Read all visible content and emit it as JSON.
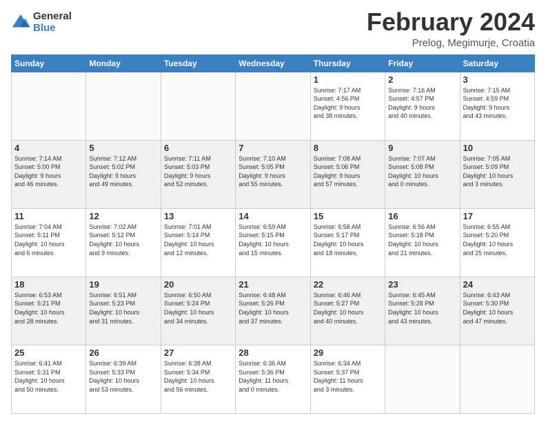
{
  "logo": {
    "general": "General",
    "blue": "Blue"
  },
  "header": {
    "title": "February 2024",
    "subtitle": "Prelog, Megimurje, Croatia"
  },
  "weekdays": [
    "Sunday",
    "Monday",
    "Tuesday",
    "Wednesday",
    "Thursday",
    "Friday",
    "Saturday"
  ],
  "weeks": [
    [
      {
        "day": "",
        "info": ""
      },
      {
        "day": "",
        "info": ""
      },
      {
        "day": "",
        "info": ""
      },
      {
        "day": "",
        "info": ""
      },
      {
        "day": "1",
        "info": "Sunrise: 7:17 AM\nSunset: 4:56 PM\nDaylight: 9 hours\nand 38 minutes."
      },
      {
        "day": "2",
        "info": "Sunrise: 7:16 AM\nSunset: 4:57 PM\nDaylight: 9 hours\nand 40 minutes."
      },
      {
        "day": "3",
        "info": "Sunrise: 7:15 AM\nSunset: 4:59 PM\nDaylight: 9 hours\nand 43 minutes."
      }
    ],
    [
      {
        "day": "4",
        "info": "Sunrise: 7:14 AM\nSunset: 5:00 PM\nDaylight: 9 hours\nand 46 minutes."
      },
      {
        "day": "5",
        "info": "Sunrise: 7:12 AM\nSunset: 5:02 PM\nDaylight: 9 hours\nand 49 minutes."
      },
      {
        "day": "6",
        "info": "Sunrise: 7:11 AM\nSunset: 5:03 PM\nDaylight: 9 hours\nand 52 minutes."
      },
      {
        "day": "7",
        "info": "Sunrise: 7:10 AM\nSunset: 5:05 PM\nDaylight: 9 hours\nand 55 minutes."
      },
      {
        "day": "8",
        "info": "Sunrise: 7:08 AM\nSunset: 5:06 PM\nDaylight: 9 hours\nand 57 minutes."
      },
      {
        "day": "9",
        "info": "Sunrise: 7:07 AM\nSunset: 5:08 PM\nDaylight: 10 hours\nand 0 minutes."
      },
      {
        "day": "10",
        "info": "Sunrise: 7:05 AM\nSunset: 5:09 PM\nDaylight: 10 hours\nand 3 minutes."
      }
    ],
    [
      {
        "day": "11",
        "info": "Sunrise: 7:04 AM\nSunset: 5:11 PM\nDaylight: 10 hours\nand 6 minutes."
      },
      {
        "day": "12",
        "info": "Sunrise: 7:02 AM\nSunset: 5:12 PM\nDaylight: 10 hours\nand 9 minutes."
      },
      {
        "day": "13",
        "info": "Sunrise: 7:01 AM\nSunset: 5:14 PM\nDaylight: 10 hours\nand 12 minutes."
      },
      {
        "day": "14",
        "info": "Sunrise: 6:59 AM\nSunset: 5:15 PM\nDaylight: 10 hours\nand 15 minutes."
      },
      {
        "day": "15",
        "info": "Sunrise: 6:58 AM\nSunset: 5:17 PM\nDaylight: 10 hours\nand 18 minutes."
      },
      {
        "day": "16",
        "info": "Sunrise: 6:56 AM\nSunset: 5:18 PM\nDaylight: 10 hours\nand 21 minutes."
      },
      {
        "day": "17",
        "info": "Sunrise: 6:55 AM\nSunset: 5:20 PM\nDaylight: 10 hours\nand 25 minutes."
      }
    ],
    [
      {
        "day": "18",
        "info": "Sunrise: 6:53 AM\nSunset: 5:21 PM\nDaylight: 10 hours\nand 28 minutes."
      },
      {
        "day": "19",
        "info": "Sunrise: 6:51 AM\nSunset: 5:23 PM\nDaylight: 10 hours\nand 31 minutes."
      },
      {
        "day": "20",
        "info": "Sunrise: 6:50 AM\nSunset: 5:24 PM\nDaylight: 10 hours\nand 34 minutes."
      },
      {
        "day": "21",
        "info": "Sunrise: 6:48 AM\nSunset: 5:26 PM\nDaylight: 10 hours\nand 37 minutes."
      },
      {
        "day": "22",
        "info": "Sunrise: 6:46 AM\nSunset: 5:27 PM\nDaylight: 10 hours\nand 40 minutes."
      },
      {
        "day": "23",
        "info": "Sunrise: 6:45 AM\nSunset: 5:28 PM\nDaylight: 10 hours\nand 43 minutes."
      },
      {
        "day": "24",
        "info": "Sunrise: 6:43 AM\nSunset: 5:30 PM\nDaylight: 10 hours\nand 47 minutes."
      }
    ],
    [
      {
        "day": "25",
        "info": "Sunrise: 6:41 AM\nSunset: 5:31 PM\nDaylight: 10 hours\nand 50 minutes."
      },
      {
        "day": "26",
        "info": "Sunrise: 6:39 AM\nSunset: 5:33 PM\nDaylight: 10 hours\nand 53 minutes."
      },
      {
        "day": "27",
        "info": "Sunrise: 6:38 AM\nSunset: 5:34 PM\nDaylight: 10 hours\nand 56 minutes."
      },
      {
        "day": "28",
        "info": "Sunrise: 6:36 AM\nSunset: 5:36 PM\nDaylight: 11 hours\nand 0 minutes."
      },
      {
        "day": "29",
        "info": "Sunrise: 6:34 AM\nSunset: 5:37 PM\nDaylight: 11 hours\nand 3 minutes."
      },
      {
        "day": "",
        "info": ""
      },
      {
        "day": "",
        "info": ""
      }
    ]
  ]
}
